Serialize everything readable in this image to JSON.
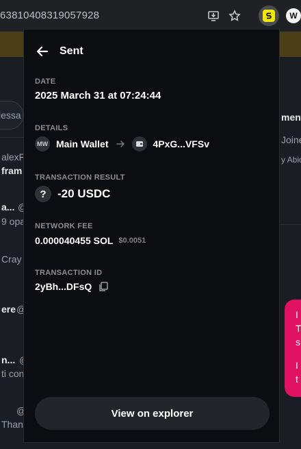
{
  "browser": {
    "url_fragment": "63810408319057928",
    "extension_w_label": "W"
  },
  "background": {
    "left_fragments": [
      "lessa",
      "alexF",
      "fram",
      "a...",
      "9 opa",
      "Cray",
      "ere",
      "n...",
      "ti con",
      "Than"
    ],
    "left_fragments_extra": [
      "@",
      "@",
      "@",
      "@"
    ],
    "right_fragments": [
      "ments",
      "Joine",
      "y Abio",
      "I",
      "T",
      "s",
      "I",
      "t"
    ]
  },
  "popup": {
    "title": "Sent",
    "date": {
      "label": "DATE",
      "value": "2025 March 31 at 07:24:44"
    },
    "details": {
      "label": "DETAILS",
      "from_avatar": "MW",
      "from_name": "Main Wallet",
      "to_address": "4PxG...VFSv"
    },
    "result": {
      "label": "TRANSACTION RESULT",
      "icon_text": "?",
      "amount": "-20 USDC"
    },
    "fee": {
      "label": "NETWORK FEE",
      "amount": "0.000040455 SOL",
      "usd": "$0.0051"
    },
    "txid": {
      "label": "TRANSACTION ID",
      "value": "2yBh...DFsQ"
    },
    "explorer_button": "View on explorer"
  },
  "colors": {
    "popup_bg": "#0b0d10",
    "accent_yellow": "#f2e80a",
    "pink": "#e0115f"
  },
  "icons": {
    "back": "arrow-left-icon",
    "arrow": "arrow-right-icon",
    "copy": "copy-icon",
    "wallet": "wallet-icon",
    "question": "question-icon",
    "star": "star-icon",
    "install": "install-app-icon"
  }
}
